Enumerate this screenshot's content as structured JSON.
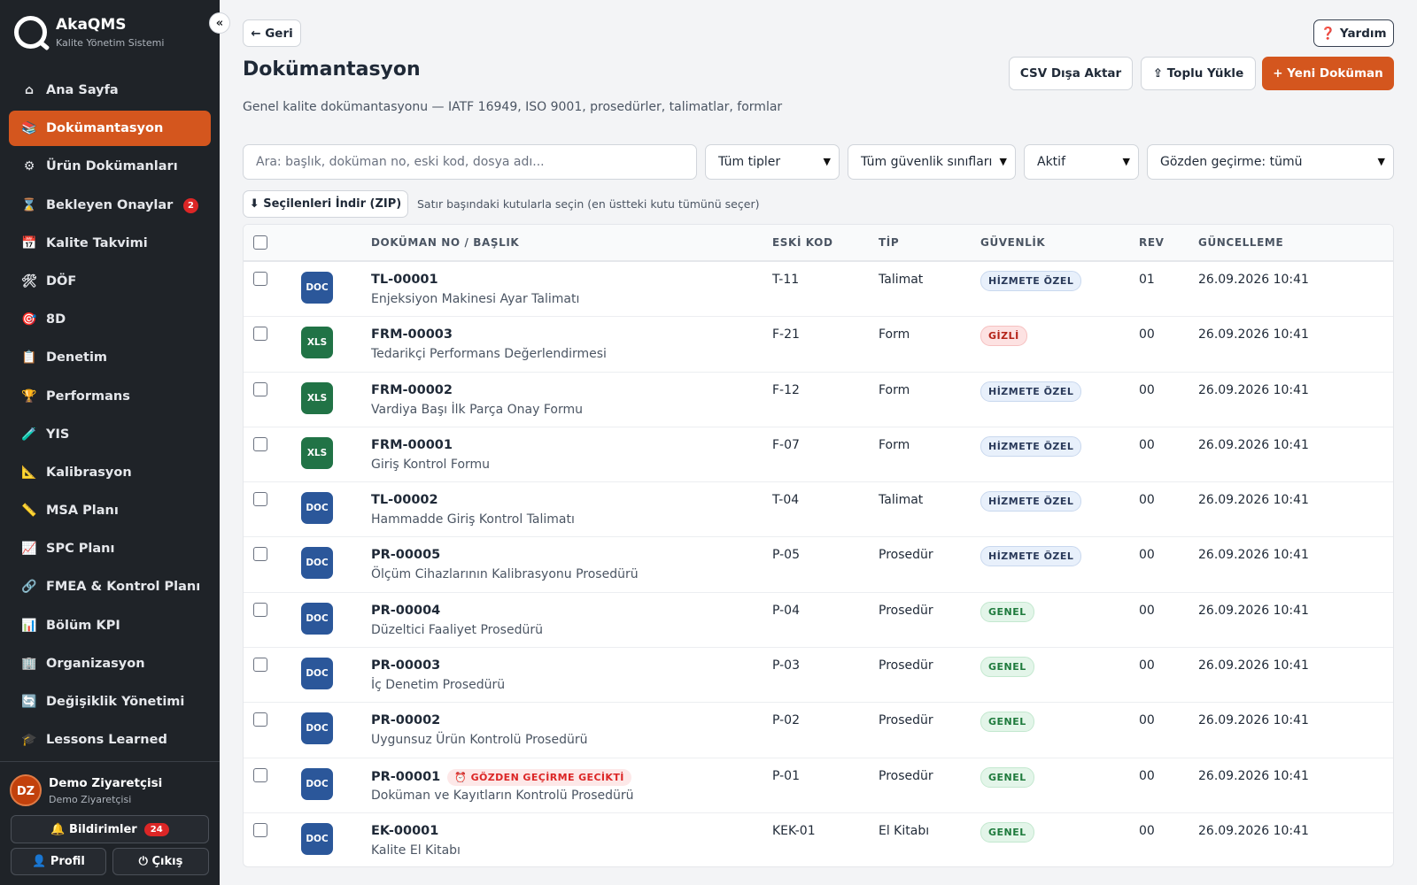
{
  "app": {
    "name": "AkaQMS",
    "subtitle": "Kalite Yönetim Sistemi",
    "collapse": "«"
  },
  "nav": [
    {
      "icon": "⌂",
      "label": "Ana Sayfa"
    },
    {
      "icon": "📚",
      "label": "Dokümantasyon",
      "active": true
    },
    {
      "icon": "⚙",
      "label": "Ürün Dokümanları"
    },
    {
      "icon": "⌛",
      "label": "Bekleyen Onaylar",
      "badge": "2"
    },
    {
      "icon": "📅",
      "label": "Kalite Takvimi"
    },
    {
      "icon": "🛠",
      "label": "DÖF"
    },
    {
      "icon": "🎯",
      "label": "8D"
    },
    {
      "icon": "📋",
      "label": "Denetim"
    },
    {
      "icon": "🏆",
      "label": "Performans"
    },
    {
      "icon": "🧪",
      "label": "YIS"
    },
    {
      "icon": "📐",
      "label": "Kalibrasyon"
    },
    {
      "icon": "📏",
      "label": "MSA Planı"
    },
    {
      "icon": "📈",
      "label": "SPC Planı"
    },
    {
      "icon": "🔗",
      "label": "FMEA & Kontrol Planı"
    },
    {
      "icon": "📊",
      "label": "Bölüm KPI"
    },
    {
      "icon": "🏢",
      "label": "Organizasyon"
    },
    {
      "icon": "🔄",
      "label": "Değişiklik Yönetimi"
    },
    {
      "icon": "🎓",
      "label": "Lessons Learned"
    }
  ],
  "user": {
    "initials": "DZ",
    "name": "Demo Ziyaretçisi",
    "role": "Demo Ziyaretçisi"
  },
  "footer": {
    "notifications": "🔔 Bildirimler",
    "notif_count": "24",
    "profile": "👤 Profil",
    "logout": "⏻ Çıkış"
  },
  "header": {
    "back": "← Geri",
    "help": "❓ Yardım",
    "title": "Dokümantasyon",
    "description": "Genel kalite dokümantasyonu — IATF 16949, ISO 9001, prosedürler, talimatlar, formlar",
    "csv": "CSV Dışa Aktar",
    "bulk": "⇪ Toplu Yükle",
    "new": "+ Yeni Doküman"
  },
  "filters": {
    "search_placeholder": "Ara: başlık, doküman no, eski kod, dosya adı...",
    "type": "Tüm tipler",
    "security": "Tüm güvenlik sınıfları",
    "status": "Aktif",
    "review": "Gözden geçirme: tümü"
  },
  "bulk": {
    "zip": "⬇ Seçilenleri İndir (ZIP)",
    "hint": "Satır başındaki kutularla seçin (en üstteki kutu tümünü seçer)"
  },
  "columns": {
    "doc": "DOKÜMAN NO / BAŞLIK",
    "old": "ESKİ KOD",
    "type": "TİP",
    "security": "GÜVENLİK",
    "rev": "REV",
    "updated": "GÜNCELLEME"
  },
  "rows": [
    {
      "ftype": "DOC",
      "no": "TL-00001",
      "title": "Enjeksiyon Makinesi Ayar Talimatı",
      "old": "T-11",
      "type": "Talimat",
      "security": "HİZMETE ÖZEL",
      "sec_class": "hizmete",
      "rev": "01",
      "updated": "26.09.2026 10:41"
    },
    {
      "ftype": "XLS",
      "no": "FRM-00003",
      "title": "Tedarikçi Performans Değerlendirmesi",
      "old": "F-21",
      "type": "Form",
      "security": "GİZLİ",
      "sec_class": "gizli",
      "rev": "00",
      "updated": "26.09.2026 10:41"
    },
    {
      "ftype": "XLS",
      "no": "FRM-00002",
      "title": "Vardiya Başı İlk Parça Onay Formu",
      "old": "F-12",
      "type": "Form",
      "security": "HİZMETE ÖZEL",
      "sec_class": "hizmete",
      "rev": "00",
      "updated": "26.09.2026 10:41"
    },
    {
      "ftype": "XLS",
      "no": "FRM-00001",
      "title": "Giriş Kontrol Formu",
      "old": "F-07",
      "type": "Form",
      "security": "HİZMETE ÖZEL",
      "sec_class": "hizmete",
      "rev": "00",
      "updated": "26.09.2026 10:41"
    },
    {
      "ftype": "DOC",
      "no": "TL-00002",
      "title": "Hammadde Giriş Kontrol Talimatı",
      "old": "T-04",
      "type": "Talimat",
      "security": "HİZMETE ÖZEL",
      "sec_class": "hizmete",
      "rev": "00",
      "updated": "26.09.2026 10:41"
    },
    {
      "ftype": "DOC",
      "no": "PR-00005",
      "title": "Ölçüm Cihazlarının Kalibrasyonu Prosedürü",
      "old": "P-05",
      "type": "Prosedür",
      "security": "HİZMETE ÖZEL",
      "sec_class": "hizmete",
      "rev": "00",
      "updated": "26.09.2026 10:41"
    },
    {
      "ftype": "DOC",
      "no": "PR-00004",
      "title": "Düzeltici Faaliyet Prosedürü",
      "old": "P-04",
      "type": "Prosedür",
      "security": "GENEL",
      "sec_class": "genel",
      "rev": "00",
      "updated": "26.09.2026 10:41"
    },
    {
      "ftype": "DOC",
      "no": "PR-00003",
      "title": "İç Denetim Prosedürü",
      "old": "P-03",
      "type": "Prosedür",
      "security": "GENEL",
      "sec_class": "genel",
      "rev": "00",
      "updated": "26.09.2026 10:41"
    },
    {
      "ftype": "DOC",
      "no": "PR-00002",
      "title": "Uygunsuz Ürün Kontrolü Prosedürü",
      "old": "P-02",
      "type": "Prosedür",
      "security": "GENEL",
      "sec_class": "genel",
      "rev": "00",
      "updated": "26.09.2026 10:41"
    },
    {
      "ftype": "DOC",
      "no": "PR-00001",
      "late": "⏰ GÖZDEN GEÇİRME GECİKTİ",
      "title": "Doküman ve Kayıtların Kontrolü Prosedürü",
      "old": "P-01",
      "type": "Prosedür",
      "security": "GENEL",
      "sec_class": "genel",
      "rev": "00",
      "updated": "26.09.2026 10:41"
    },
    {
      "ftype": "DOC",
      "no": "EK-00001",
      "title": "Kalite El Kitabı",
      "old": "KEK-01",
      "type": "El Kitabı",
      "security": "GENEL",
      "sec_class": "genel",
      "rev": "00",
      "updated": "26.09.2026 10:41"
    }
  ]
}
